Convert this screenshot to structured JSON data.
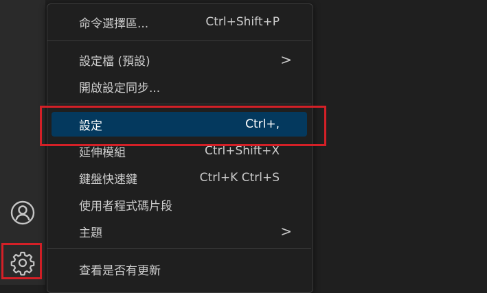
{
  "menu": {
    "items": [
      {
        "label": "命令選擇區...",
        "shortcut": "Ctrl+Shift+P"
      },
      {
        "label": "設定檔 (預設)",
        "submenu": ">"
      },
      {
        "label": "開啟設定同步..."
      },
      {
        "label": "設定",
        "shortcut": "Ctrl+,"
      },
      {
        "label": "延伸模組",
        "shortcut": "Ctrl+Shift+X"
      },
      {
        "label": "鍵盤快速鍵",
        "shortcut": "Ctrl+K Ctrl+S"
      },
      {
        "label": "使用者程式碼片段"
      },
      {
        "label": "主題",
        "submenu": ">"
      },
      {
        "label": "查看是否有更新"
      }
    ]
  },
  "activity_bar": {
    "icons": [
      "account-icon",
      "gear-icon"
    ]
  },
  "colors": {
    "accent_selection": "#04395e",
    "highlight_border": "#d42027",
    "text": "#cccccc"
  }
}
